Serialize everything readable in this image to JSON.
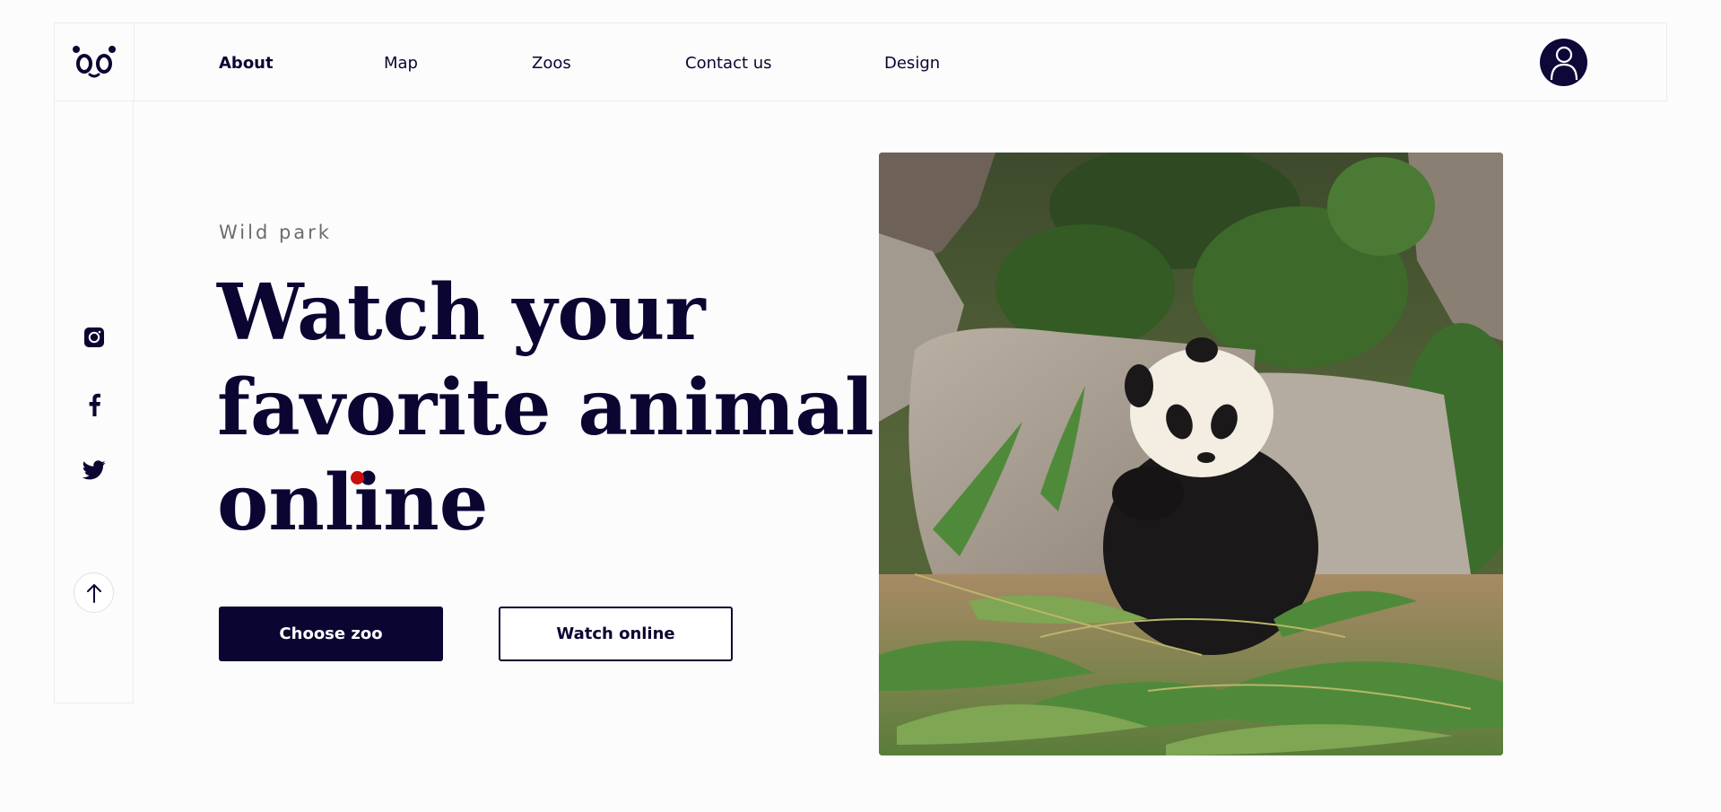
{
  "header": {
    "logo_icon": "panda-logo-icon",
    "nav": [
      {
        "label": "About",
        "active": true
      },
      {
        "label": "Map",
        "active": false
      },
      {
        "label": "Zoos",
        "active": false
      },
      {
        "label": "Contact us",
        "active": false
      },
      {
        "label": "Design",
        "active": false
      }
    ],
    "avatar_icon": "user-icon"
  },
  "sidebar": {
    "social": [
      {
        "icon": "instagram-icon"
      },
      {
        "icon": "facebook-icon"
      },
      {
        "icon": "twitter-icon"
      }
    ],
    "scroll_icon": "arrow-up-icon"
  },
  "hero": {
    "eyebrow": "Wild park",
    "headline_line1": "Watch your",
    "headline_line2": "favorite animal",
    "headline_line3": "online",
    "primary_button": "Choose zoo",
    "secondary_button": "Watch online",
    "image_icon": "panda-photo"
  },
  "colors": {
    "primary": "#0b0532",
    "accent": "#c80e0e",
    "background": "#fcfcfc",
    "border": "#ececec"
  }
}
